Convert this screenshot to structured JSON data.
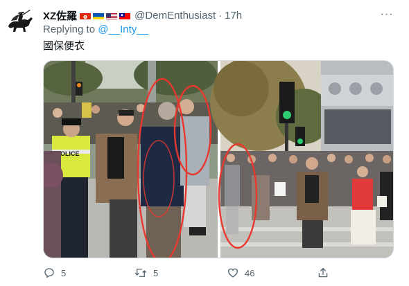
{
  "tweet": {
    "display_name": "XZ佐羅",
    "flags": [
      "hong-kong-flag",
      "ukraine-flag",
      "usa-flag",
      "taiwan-flag"
    ],
    "handle": "@DemEnthusiast",
    "separator": "·",
    "time": "17h",
    "more_label": "···",
    "replying_to_prefix": "Replying to ",
    "replying_to_handle": "@__Inty__",
    "text": "國保便衣",
    "avatar_icon": "zorro-horse-rider-avatar-icon"
  },
  "media": {
    "left_image": {
      "vest_text": "POLICE"
    },
    "annotation_color": "#e8382f"
  },
  "actions": {
    "reply_count": "5",
    "retweet_count": "5",
    "like_count": "46",
    "icons": [
      "reply-icon",
      "retweet-icon",
      "like-icon",
      "share-icon"
    ]
  },
  "colors": {
    "text_primary": "#0f1419",
    "text_secondary": "#536471",
    "link": "#1d9bf0"
  }
}
